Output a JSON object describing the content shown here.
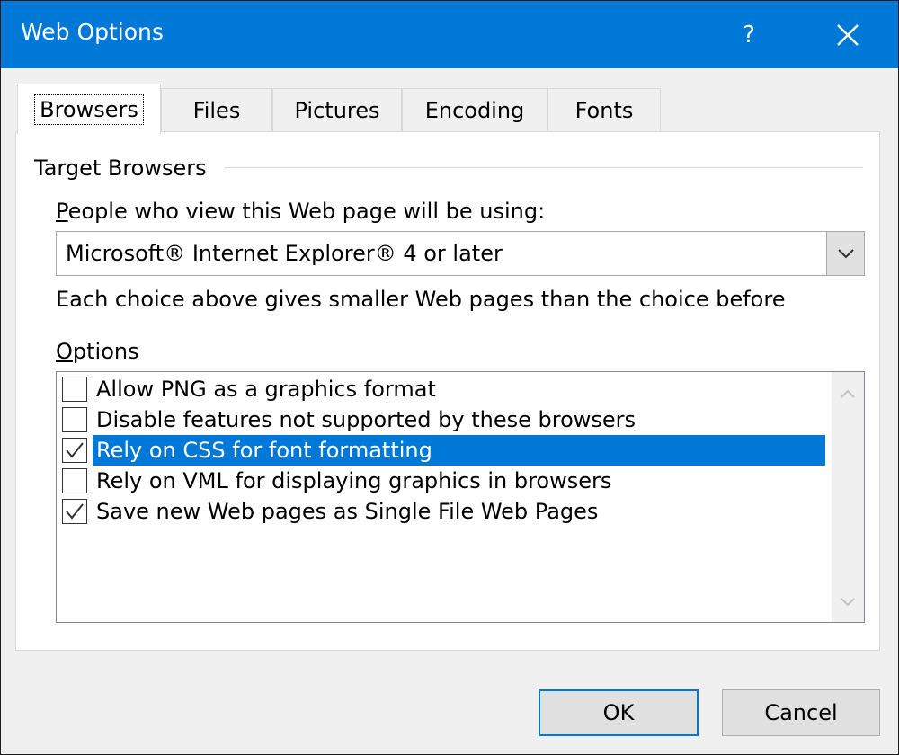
{
  "window": {
    "title": "Web Options",
    "help_label": "?",
    "accent_color": "#0078d7",
    "close_icon": "close-icon"
  },
  "tabs": [
    {
      "label": "Browsers",
      "active": true
    },
    {
      "label": "Files",
      "active": false
    },
    {
      "label": "Pictures",
      "active": false
    },
    {
      "label": "Encoding",
      "active": false
    },
    {
      "label": "Fonts",
      "active": false
    }
  ],
  "target_browsers": {
    "group_label": "Target Browsers",
    "people_label_accel": "P",
    "people_label_rest": "eople who view this Web page will be using:",
    "selected_browser": "Microsoft® Internet Explorer® 4 or later",
    "hint": "Each choice above gives smaller Web pages than the choice before"
  },
  "options": {
    "label_accel": "O",
    "label_rest": "ptions",
    "items": [
      {
        "label": "Allow PNG as a graphics format",
        "checked": false,
        "selected": false
      },
      {
        "label": "Disable features not supported by these browsers",
        "checked": false,
        "selected": false
      },
      {
        "label": "Rely on CSS for font formatting",
        "checked": true,
        "selected": true
      },
      {
        "label": "Rely on VML for displaying graphics in browsers",
        "checked": false,
        "selected": false
      },
      {
        "label": "Save new Web pages as Single File Web Pages",
        "checked": true,
        "selected": false
      }
    ]
  },
  "buttons": {
    "ok": "OK",
    "cancel": "Cancel"
  }
}
